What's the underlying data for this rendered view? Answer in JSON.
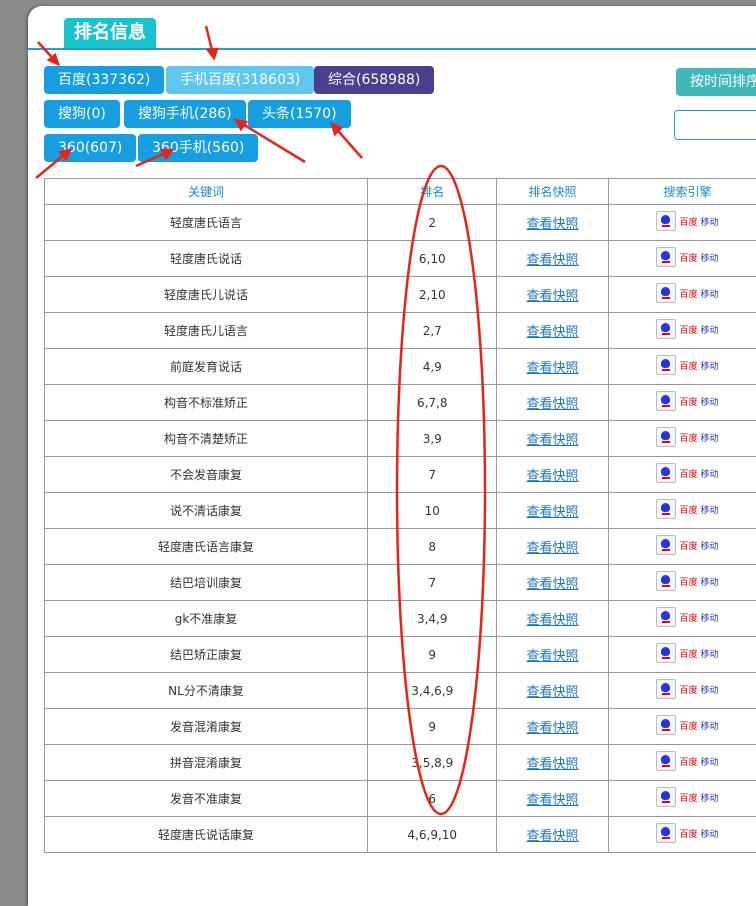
{
  "header": {
    "title": "排名信息"
  },
  "filters": [
    {
      "label": "百度(337362)"
    },
    {
      "label": "手机百度(318603)"
    },
    {
      "label": "综合(658988)"
    },
    {
      "label": "按时间排序"
    },
    {
      "label": "搜狗(0)"
    },
    {
      "label": "搜狗手机(286)"
    },
    {
      "label": "头条(1570)"
    },
    {
      "label": "360(607)"
    },
    {
      "label": "360手机(560)"
    }
  ],
  "table": {
    "headers": [
      "关键词",
      "排名",
      "排名快照",
      "搜索引擎"
    ],
    "snapshot_label": "查看快照",
    "engine": {
      "name1": "百度",
      "name2": "移动",
      "icon": "baidu-paw-icon"
    },
    "rows": [
      {
        "keyword": "轻度唐氏语言",
        "rank": "2"
      },
      {
        "keyword": "轻度唐氏说话",
        "rank": "6,10"
      },
      {
        "keyword": "轻度唐氏儿说话",
        "rank": "2,10"
      },
      {
        "keyword": "轻度唐氏儿语言",
        "rank": "2,7"
      },
      {
        "keyword": "前庭发育说话",
        "rank": "4,9"
      },
      {
        "keyword": "构音不标准矫正",
        "rank": "6,7,8"
      },
      {
        "keyword": "构音不清楚矫正",
        "rank": "3,9"
      },
      {
        "keyword": "不会发音康复",
        "rank": "7"
      },
      {
        "keyword": "说不清话康复",
        "rank": "10"
      },
      {
        "keyword": "轻度唐氏语言康复",
        "rank": "8"
      },
      {
        "keyword": "结巴培训康复",
        "rank": "7"
      },
      {
        "keyword": "gk不准康复",
        "rank": "3,4,9"
      },
      {
        "keyword": "结巴矫正康复",
        "rank": "9"
      },
      {
        "keyword": "NL分不清康复",
        "rank": "3,4,6,9"
      },
      {
        "keyword": "发音混淆康复",
        "rank": "9"
      },
      {
        "keyword": "拼音混淆康复",
        "rank": "3,5,8,9"
      },
      {
        "keyword": "发音不准康复",
        "rank": "6"
      },
      {
        "keyword": "轻度唐氏说话康复",
        "rank": "4,6,9,10"
      }
    ]
  },
  "annotations": {
    "color": "#e8231a"
  }
}
